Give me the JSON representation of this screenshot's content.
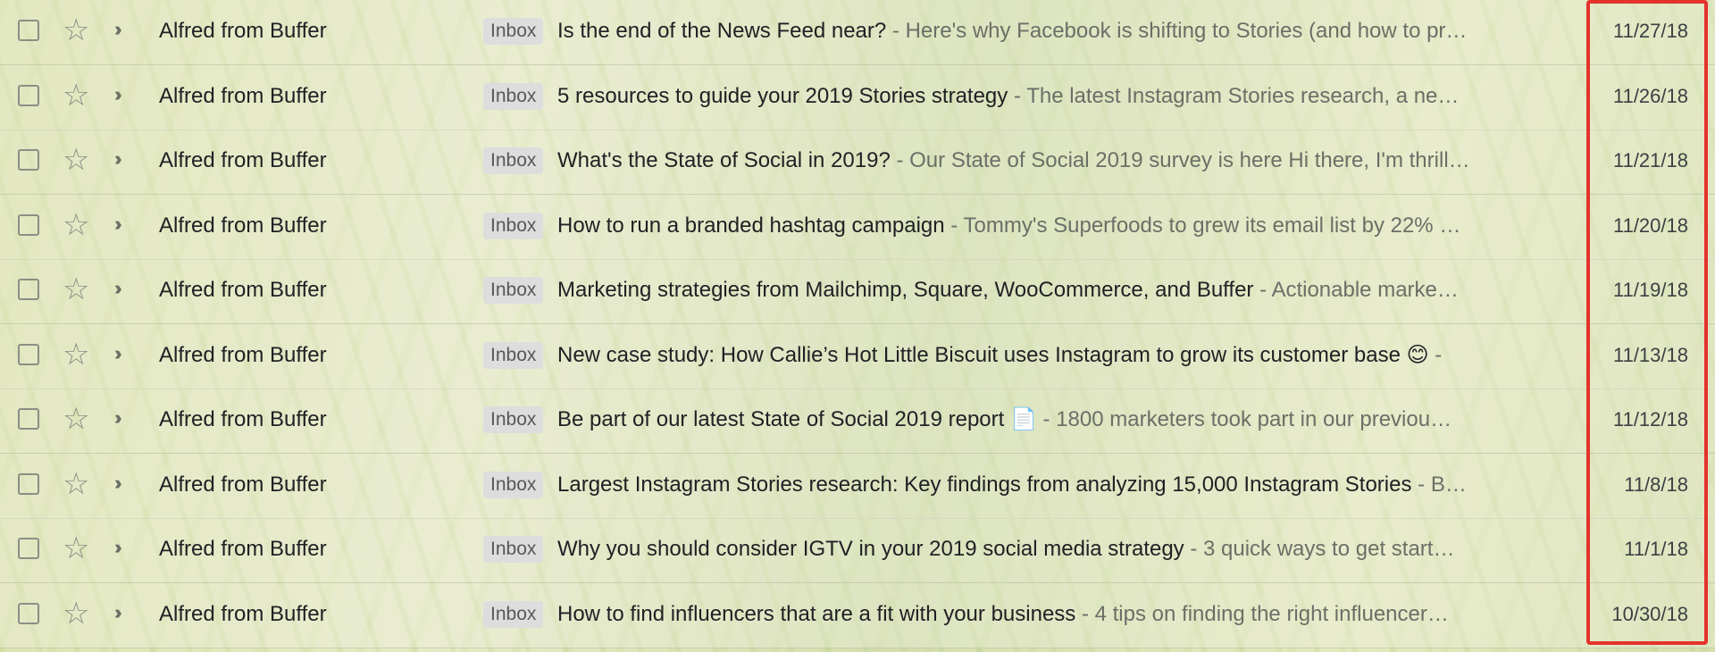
{
  "emails": [
    {
      "sender": "Alfred from Buffer",
      "label": "Inbox",
      "subject": "Is the end of the News Feed near?",
      "snippet": "Here's why Facebook is shifting to Stories (and how to pr…",
      "date": "11/27/18"
    },
    {
      "sender": "Alfred from Buffer",
      "label": "Inbox",
      "subject": "5 resources to guide your 2019 Stories strategy",
      "snippet": "The latest Instagram Stories research, a ne…",
      "date": "11/26/18"
    },
    {
      "sender": "Alfred from Buffer",
      "label": "Inbox",
      "subject": "What's the State of Social in 2019?",
      "snippet": "Our State of Social 2019 survey is here Hi there, I'm thrill…",
      "date": "11/21/18"
    },
    {
      "sender": "Alfred from Buffer",
      "label": "Inbox",
      "subject": "How to run a branded hashtag campaign",
      "snippet": "Tommy's Superfoods to grew its email list by 22% …",
      "date": "11/20/18"
    },
    {
      "sender": "Alfred from Buffer",
      "label": "Inbox",
      "subject": "Marketing strategies from Mailchimp, Square, WooCommerce, and Buffer",
      "snippet": "Actionable marke…",
      "date": "11/19/18"
    },
    {
      "sender": "Alfred from Buffer",
      "label": "Inbox",
      "subject": "New case study: How Callie’s Hot Little Biscuit uses Instagram to grow its customer base 😊",
      "snippet": "",
      "date": "11/13/18"
    },
    {
      "sender": "Alfred from Buffer",
      "label": "Inbox",
      "subject": "Be part of our latest State of Social 2019 report 📄",
      "snippet": "1800 marketers took part in our previou…",
      "date": "11/12/18"
    },
    {
      "sender": "Alfred from Buffer",
      "label": "Inbox",
      "subject": "Largest Instagram Stories research: Key findings from analyzing 15,000 Instagram Stories",
      "snippet": "B…",
      "date": "11/8/18"
    },
    {
      "sender": "Alfred from Buffer",
      "label": "Inbox",
      "subject": "Why you should consider IGTV in your 2019 social media strategy",
      "snippet": "3 quick ways to get start…",
      "date": "11/1/18"
    },
    {
      "sender": "Alfred from Buffer",
      "label": "Inbox",
      "subject": "How to find influencers that are a fit with your business",
      "snippet": "4 tips on finding the right influencer…",
      "date": "10/30/18"
    }
  ],
  "separator": " - ",
  "icons": {
    "checkbox": "checkbox-icon",
    "star": "star-icon",
    "important": "important-marker-icon"
  },
  "colors": {
    "highlight": "#e5322d",
    "label_bg": "#dddddd",
    "text": "#202124",
    "snippet": "#6b6f66"
  }
}
